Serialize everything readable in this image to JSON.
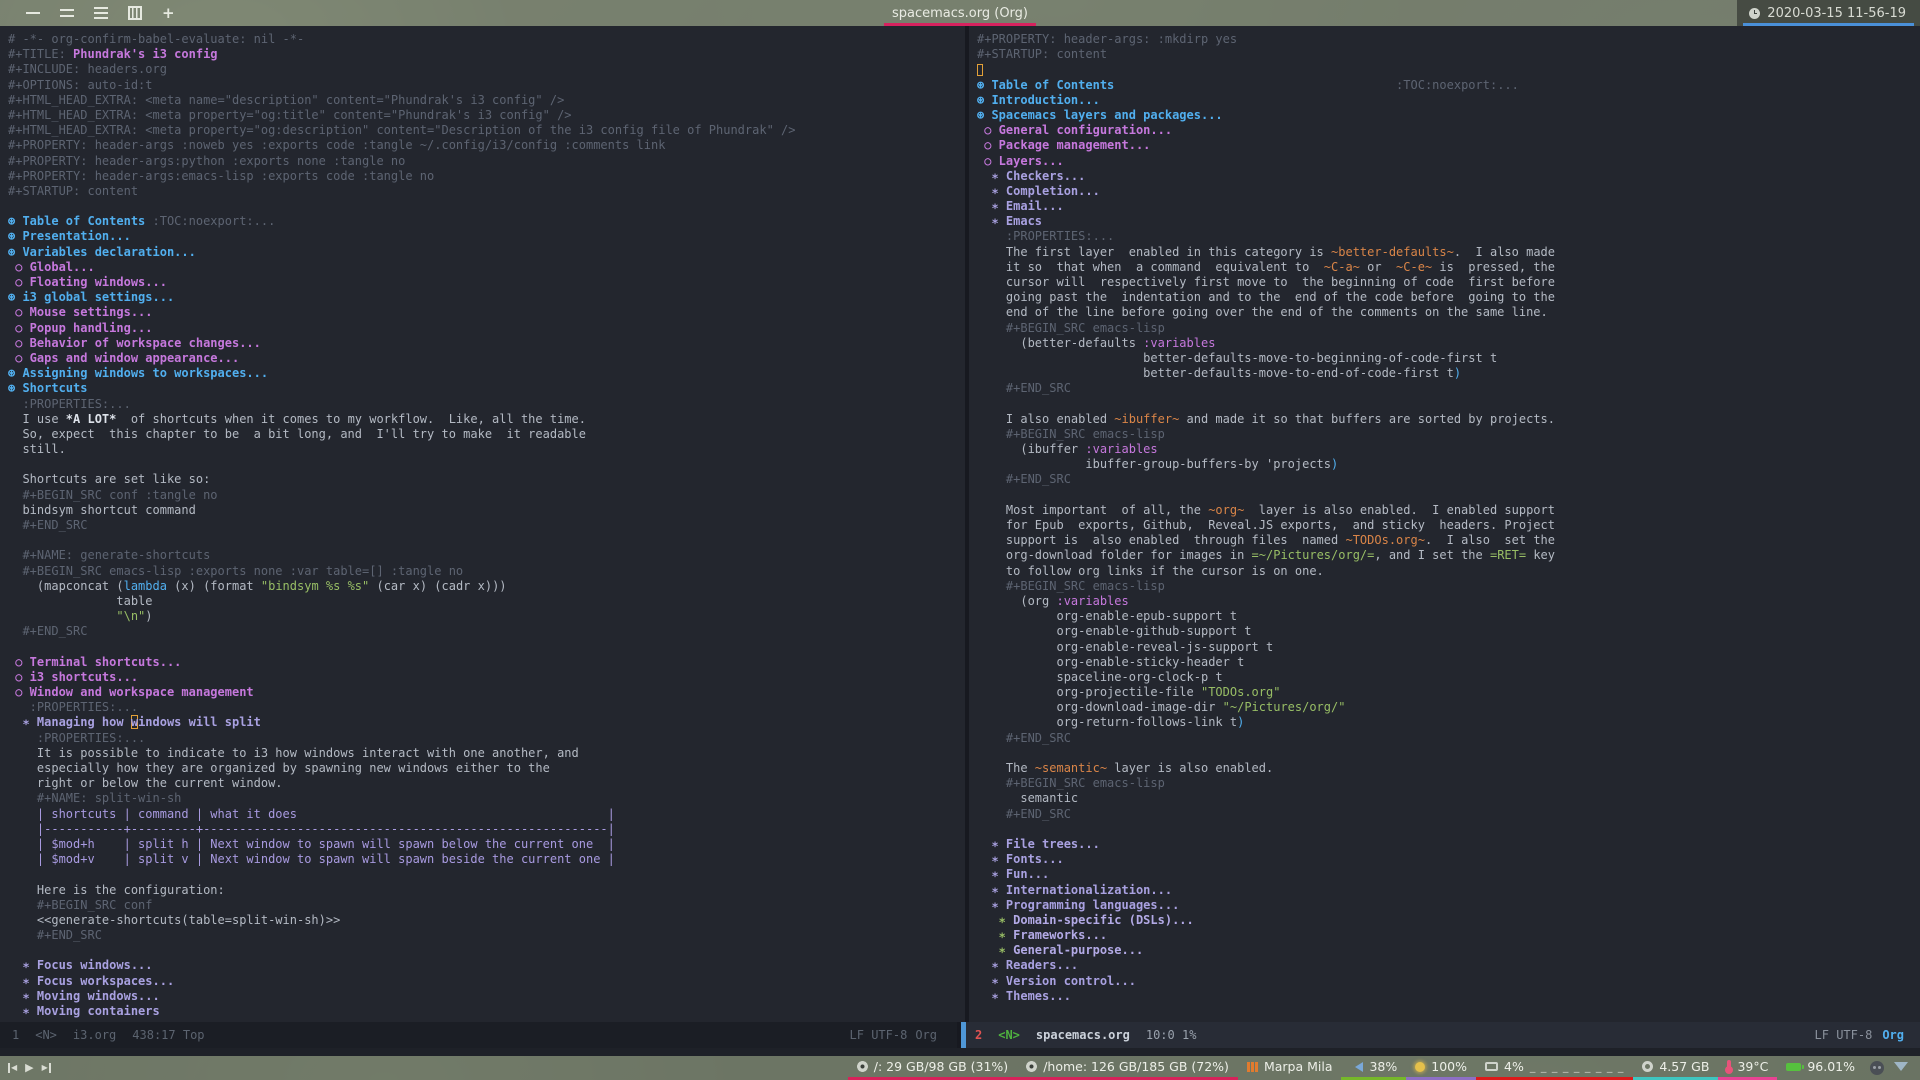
{
  "topbar": {
    "title": "spacemacs.org (Org)",
    "title_underline": "#d7225f",
    "clock": "2020-03-15 11-56-19",
    "clock_underline": "#4a90d9",
    "workspaces": [
      {
        "name": "workspace-1",
        "glyph": "one"
      },
      {
        "name": "workspace-2",
        "glyph": "two"
      },
      {
        "name": "workspace-3",
        "glyph": "three"
      },
      {
        "name": "workspace-4",
        "glyph": "four"
      },
      {
        "name": "new-workspace-button",
        "glyph": "plus",
        "text": "+"
      }
    ]
  },
  "buffers": {
    "left": {
      "buffer_name": "i3.org",
      "lines": [
        [
          [
            "m",
            "# -*- org-confirm-babel-evaluate: nil -*-"
          ]
        ],
        [
          [
            "m",
            "#+TITLE: "
          ],
          [
            "title",
            "Phundrak's i3 config"
          ]
        ],
        [
          [
            "m",
            "#+INCLUDE: headers.org"
          ]
        ],
        [
          [
            "m",
            "#+OPTIONS: auto-id:t"
          ]
        ],
        [
          [
            "m",
            "#+HTML_HEAD_EXTRA: <meta name=\"description\" content=\"Phundrak's i3 config\" />"
          ]
        ],
        [
          [
            "m",
            "#+HTML_HEAD_EXTRA: <meta property=\"og:title\" content=\"Phundrak's i3 config\" />"
          ]
        ],
        [
          [
            "m",
            "#+HTML_HEAD_EXTRA: <meta property=\"og:description\" content=\"Description of the i3 config file of Phundrak\" />"
          ]
        ],
        [
          [
            "m",
            "#+PROPERTY: header-args :noweb yes :exports code :tangle ~/.config/i3/config :comments link"
          ]
        ],
        [
          [
            "m",
            "#+PROPERTY: header-args:python :exports none :tangle no"
          ]
        ],
        [
          [
            "m",
            "#+PROPERTY: header-args:emacs-lisp :exports code :tangle no"
          ]
        ],
        [
          [
            "m",
            "#+STARTUP: content"
          ]
        ],
        [],
        [
          [
            "k1",
            "⊛ Table of Contents "
          ],
          [
            "tag",
            ":TOC:noexport:..."
          ]
        ],
        [
          [
            "k1",
            "⊛ Presentation..."
          ]
        ],
        [
          [
            "k1",
            "⊛ Variables declaration..."
          ]
        ],
        [
          [
            "k2",
            " ○ Global..."
          ]
        ],
        [
          [
            "k2",
            " ○ Floating windows..."
          ]
        ],
        [
          [
            "k1",
            "⊛ i3 global settings..."
          ]
        ],
        [
          [
            "k2",
            " ○ Mouse settings..."
          ]
        ],
        [
          [
            "k2",
            " ○ Popup handling..."
          ]
        ],
        [
          [
            "k2",
            " ○ Behavior of workspace changes..."
          ]
        ],
        [
          [
            "k2",
            " ○ Gaps and window appearance..."
          ]
        ],
        [
          [
            "k1",
            "⊛ Assigning windows to workspaces..."
          ]
        ],
        [
          [
            "k1",
            "⊛ Shortcuts"
          ]
        ],
        [
          [
            "m",
            "  :PROPERTIES:..."
          ]
        ],
        [
          [
            "d",
            "  I use "
          ],
          [
            "b",
            "*A LOT*"
          ],
          [
            "d",
            "  of shortcuts when it comes to my workflow.  Like, all the time."
          ]
        ],
        [
          [
            "d",
            "  So, expect  this chapter to be  a bit long, and  I'll try to make  it readable"
          ]
        ],
        [
          [
            "d",
            "  still."
          ]
        ],
        [],
        [
          [
            "d",
            "  Shortcuts are set like so:"
          ]
        ],
        [
          [
            "m",
            "  #+BEGIN_SRC conf :tangle no"
          ]
        ],
        [
          [
            "d",
            "  bindsym shortcut command"
          ]
        ],
        [
          [
            "m",
            "  #+END_SRC"
          ]
        ],
        [],
        [
          [
            "m",
            "  #+NAME: generate-shortcuts"
          ]
        ],
        [
          [
            "m",
            "  #+BEGIN_SRC emacs-lisp :exports none :var table=[] :tangle no"
          ]
        ],
        [
          [
            "d",
            "    (mapconcat ("
          ],
          [
            "kw",
            "lambda"
          ],
          [
            "d",
            " (x) (format "
          ],
          [
            "str",
            "\"bindsym %s %s\""
          ],
          [
            "d",
            " (car x) (cadr x)))"
          ]
        ],
        [
          [
            "d",
            "               table"
          ]
        ],
        [
          [
            "d",
            "               "
          ],
          [
            "str",
            "\"\\n\""
          ],
          [
            "d",
            ")"
          ]
        ],
        [
          [
            "m",
            "  #+END_SRC"
          ]
        ],
        [],
        [
          [
            "k2",
            " ○ Terminal shortcuts..."
          ]
        ],
        [
          [
            "k2",
            " ○ i3 shortcuts..."
          ]
        ],
        [
          [
            "k2",
            " ○ Window and workspace management"
          ]
        ],
        [
          [
            "m",
            "   :PROPERTIES:..."
          ]
        ],
        [
          [
            "k3",
            "  ∗ Managing how "
          ],
          [
            "cur3",
            "w"
          ],
          [
            "k3",
            "indows will split"
          ]
        ],
        [
          [
            "m",
            "    :PROPERTIES:..."
          ]
        ],
        [
          [
            "d",
            "    It is possible to indicate to i3 how windows interact with one another, and"
          ]
        ],
        [
          [
            "d",
            "    especially how they are organized by spawning new windows either to the"
          ]
        ],
        [
          [
            "d",
            "    right or below the current window."
          ]
        ],
        [
          [
            "m",
            "    #+NAME: split-win-sh"
          ]
        ],
        [
          [
            "tbl",
            "    | shortcuts | command | what it does                                           |"
          ]
        ],
        [
          [
            "tbl",
            "    |-----------+---------+--------------------------------------------------------|"
          ]
        ],
        [
          [
            "tbl",
            "    | $mod+h    | split h | Next window to spawn will spawn below the current one  |"
          ]
        ],
        [
          [
            "tbl",
            "    | $mod+v    | split v | Next window to spawn will spawn beside the current one |"
          ]
        ],
        [],
        [
          [
            "d",
            "    Here is the configuration:"
          ]
        ],
        [
          [
            "m",
            "    #+BEGIN_SRC conf"
          ]
        ],
        [
          [
            "d",
            "    <<generate-shortcuts(table=split-win-sh)>>"
          ]
        ],
        [
          [
            "m",
            "    #+END_SRC"
          ]
        ],
        [],
        [
          [
            "k3",
            "  ∗ Focus windows..."
          ]
        ],
        [
          [
            "k3",
            "  ∗ Focus workspaces..."
          ]
        ],
        [
          [
            "k3",
            "  ∗ Moving windows..."
          ]
        ],
        [
          [
            "k3",
            "  ∗ Moving containers"
          ]
        ]
      ]
    },
    "right": {
      "buffer_name": "spacemacs.org",
      "lines": [
        [
          [
            "m",
            "#+PROPERTY: header-args: :mkdirp yes"
          ]
        ],
        [
          [
            "m",
            "#+STARTUP: content"
          ]
        ],
        [
          [
            "curb",
            ""
          ]
        ],
        [
          [
            "k1",
            "⊛ Table of Contents"
          ],
          [
            "d",
            "                                       "
          ],
          [
            "tag",
            ":TOC:noexport:..."
          ]
        ],
        [
          [
            "k1",
            "⊛ Introduction..."
          ]
        ],
        [
          [
            "k1",
            "⊛ Spacemacs layers and packages..."
          ]
        ],
        [
          [
            "k2",
            " ○ General configuration..."
          ]
        ],
        [
          [
            "k2",
            " ○ Package management..."
          ]
        ],
        [
          [
            "k2",
            " ○ Layers..."
          ]
        ],
        [
          [
            "k3",
            "  ∗ Checkers..."
          ]
        ],
        [
          [
            "k3",
            "  ∗ Completion..."
          ]
        ],
        [
          [
            "k3",
            "  ∗ Email..."
          ]
        ],
        [
          [
            "k3",
            "  ∗ Emacs"
          ]
        ],
        [
          [
            "m",
            "    :PROPERTIES:..."
          ]
        ],
        [
          [
            "d",
            "    The first layer  enabled in this category is "
          ],
          [
            "code",
            "~better-defaults~"
          ],
          [
            "d",
            ".  I also made"
          ]
        ],
        [
          [
            "d",
            "    it so  that when  a command  equivalent to  "
          ],
          [
            "code",
            "~C-a~"
          ],
          [
            "d",
            " or  "
          ],
          [
            "code",
            "~C-e~"
          ],
          [
            "d",
            " is  pressed, the"
          ]
        ],
        [
          [
            "d",
            "    cursor will  respectively first move to  the beginning of code  first before"
          ]
        ],
        [
          [
            "d",
            "    going past the  indentation and to the  end of the code before  going to the"
          ]
        ],
        [
          [
            "d",
            "    end of the line before going over the end of the comments on the same line."
          ]
        ],
        [
          [
            "m",
            "    #+BEGIN_SRC emacs-lisp"
          ]
        ],
        [
          [
            "d",
            "      (better-defaults "
          ],
          [
            "var",
            ":variables"
          ]
        ],
        [
          [
            "d",
            "                       better-defaults-move-to-beginning-of-code-first t"
          ]
        ],
        [
          [
            "d",
            "                       better-defaults-move-to-end-of-code-first t"
          ],
          [
            "kw",
            ")"
          ]
        ],
        [
          [
            "m",
            "    #+END_SRC"
          ]
        ],
        [],
        [
          [
            "d",
            "    I also enabled "
          ],
          [
            "code",
            "~ibuffer~"
          ],
          [
            "d",
            " and made it so that buffers are sorted by projects."
          ]
        ],
        [
          [
            "m",
            "    #+BEGIN_SRC emacs-lisp"
          ]
        ],
        [
          [
            "d",
            "      (ibuffer "
          ],
          [
            "var",
            ":variables"
          ]
        ],
        [
          [
            "d",
            "               ibuffer-group-buffers-by 'projects"
          ],
          [
            "kw",
            ")"
          ]
        ],
        [
          [
            "m",
            "    #+END_SRC"
          ]
        ],
        [],
        [
          [
            "d",
            "    Most important  of all, the "
          ],
          [
            "code",
            "~org~"
          ],
          [
            "d",
            "  layer is also enabled.  I enabled support"
          ]
        ],
        [
          [
            "d",
            "    for Epub  exports, Github,  Reveal.JS exports,  and sticky  headers. Project"
          ]
        ],
        [
          [
            "d",
            "    support is  also enabled  through files  named "
          ],
          [
            "code",
            "~TODOs.org~"
          ],
          [
            "d",
            ".  I also  set the"
          ]
        ],
        [
          [
            "d",
            "    org-download folder for images in "
          ],
          [
            "verb",
            "=~/Pictures/org/="
          ],
          [
            "d",
            ", and I set the "
          ],
          [
            "verb",
            "=RET="
          ],
          [
            "d",
            " key"
          ]
        ],
        [
          [
            "d",
            "    to follow org links if the cursor is on one."
          ]
        ],
        [
          [
            "m",
            "    #+BEGIN_SRC emacs-lisp"
          ]
        ],
        [
          [
            "d",
            "      (org "
          ],
          [
            "var",
            ":variables"
          ]
        ],
        [
          [
            "d",
            "           org-enable-epub-support t"
          ]
        ],
        [
          [
            "d",
            "           org-enable-github-support t"
          ]
        ],
        [
          [
            "d",
            "           org-enable-reveal-js-support t"
          ]
        ],
        [
          [
            "d",
            "           org-enable-sticky-header t"
          ]
        ],
        [
          [
            "d",
            "           spaceline-org-clock-p t"
          ]
        ],
        [
          [
            "d",
            "           org-projectile-file "
          ],
          [
            "str",
            "\"TODOs.org\""
          ]
        ],
        [
          [
            "d",
            "           org-download-image-dir "
          ],
          [
            "str",
            "\"~/Pictures/org/\""
          ]
        ],
        [
          [
            "d",
            "           org-return-follows-link t"
          ],
          [
            "kw",
            ")"
          ]
        ],
        [
          [
            "m",
            "    #+END_SRC"
          ]
        ],
        [],
        [
          [
            "d",
            "    The "
          ],
          [
            "code",
            "~semantic~"
          ],
          [
            "d",
            " layer is also enabled."
          ]
        ],
        [
          [
            "m",
            "    #+BEGIN_SRC emacs-lisp"
          ]
        ],
        [
          [
            "d",
            "      semantic"
          ]
        ],
        [
          [
            "m",
            "    #+END_SRC"
          ]
        ],
        [],
        [
          [
            "k3",
            "  ∗ File trees..."
          ]
        ],
        [
          [
            "k3",
            "  ∗ Fonts..."
          ]
        ],
        [
          [
            "k3",
            "  ∗ Fun..."
          ]
        ],
        [
          [
            "k3",
            "  ∗ Internationalization..."
          ]
        ],
        [
          [
            "k3",
            "  ∗ Programming languages..."
          ]
        ],
        [
          [
            "k4b",
            "   ∗ "
          ],
          [
            "k4",
            "Domain-specific (DSLs)..."
          ]
        ],
        [
          [
            "k4b",
            "   ∗ "
          ],
          [
            "k4",
            "Frameworks..."
          ]
        ],
        [
          [
            "k4b",
            "   ∗ "
          ],
          [
            "k4",
            "General-purpose..."
          ]
        ],
        [
          [
            "k3",
            "  ∗ Readers..."
          ]
        ],
        [
          [
            "k3",
            "  ∗ Version control..."
          ]
        ],
        [
          [
            "k3",
            "  ∗ Themes..."
          ]
        ]
      ]
    }
  },
  "modelines": {
    "left": {
      "win": "1",
      "state": "<N>",
      "buffer": "i3.org",
      "position": "438:17 Top",
      "encoding": "LF UTF-8",
      "mode": "Org"
    },
    "right": {
      "win": "2",
      "state": "<N>",
      "buffer": "spacemacs.org",
      "position": "10:0  1%",
      "encoding": "LF UTF-8",
      "mode": "Org"
    }
  },
  "bottombar": {
    "media": [
      {
        "name": "previous-track-button",
        "glyph": "prev",
        "char": "◀"
      },
      {
        "name": "play-button",
        "glyph": "play",
        "char": "▶"
      },
      {
        "name": "next-track-button",
        "glyph": "next",
        "char": "▶"
      }
    ],
    "stats": [
      {
        "id": "root-disk",
        "icon": "disk-icon",
        "glyph": "disk",
        "label": "/: 29 GB/98 GB (31%)",
        "underline": "#d7225a"
      },
      {
        "id": "home-disk",
        "icon": "disk-icon",
        "glyph": "disk",
        "label": "/home: 126 GB/185 GB (72%)",
        "underline": "#d7225a"
      },
      {
        "id": "now-playing",
        "icon": "music-icon",
        "glyph": "eq",
        "label": "Marpa Mila",
        "underline": ""
      },
      {
        "id": "volume",
        "icon": "volume-icon",
        "glyph": "vol",
        "label": "38%",
        "underline": "#76b82a"
      },
      {
        "id": "brightness",
        "icon": "brightness-icon",
        "glyph": "sun",
        "label": "100%",
        "underline": "#8d6fc4"
      },
      {
        "id": "cpu",
        "icon": "cpu-icon",
        "glyph": "cpu",
        "label": "4%",
        "trail": "_ _ _ _ _ _ _ _ _",
        "underline": "#dc1a1a"
      },
      {
        "id": "memory",
        "icon": "memory-icon",
        "glyph": "mem",
        "label": "4.57 GB",
        "underline": "#3fc6c0"
      },
      {
        "id": "temperature",
        "icon": "temperature-icon",
        "glyph": "temp",
        "label": "39°C",
        "underline": "#e84393"
      },
      {
        "id": "battery",
        "icon": "battery-icon",
        "glyph": "batt",
        "label": "96.01%",
        "underline": ""
      }
    ],
    "tray": [
      {
        "name": "discord-tray-button",
        "icon": "discord-icon",
        "glyph": "discord"
      },
      {
        "name": "network-tray-button",
        "icon": "network-icon",
        "glyph": "wifi"
      }
    ]
  }
}
